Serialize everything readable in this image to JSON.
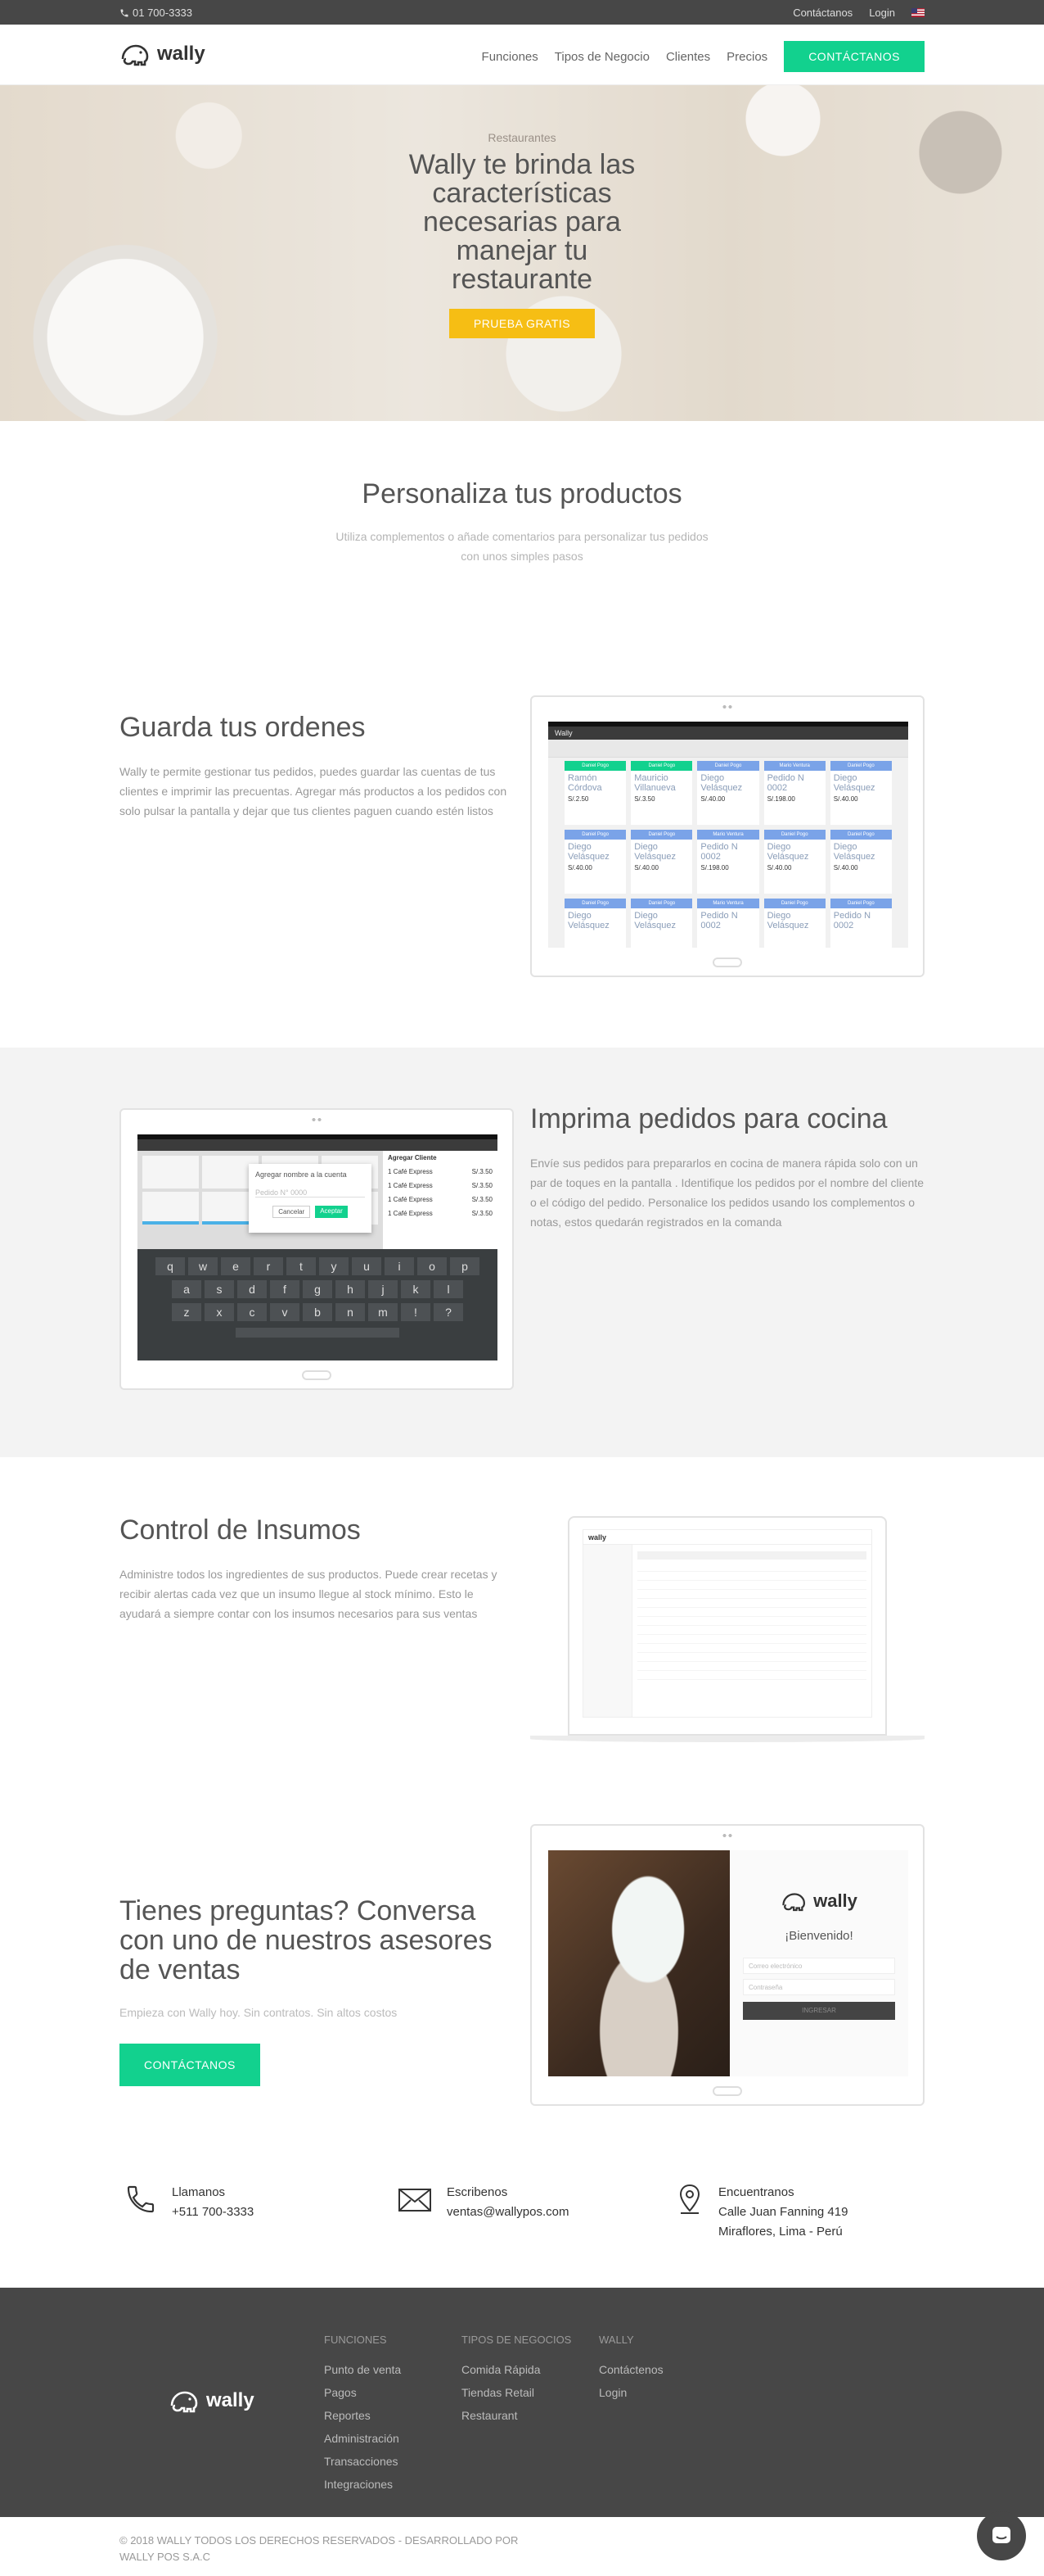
{
  "topbar": {
    "phone": "01 700-3333",
    "contact": "Contáctanos",
    "login": "Login",
    "lang_icon": "us-flag-icon"
  },
  "nav": {
    "logo": "wally",
    "items": [
      "Funciones",
      "Tipos de Negocio",
      "Clientes",
      "Precios"
    ],
    "cta": "CONTÁCTANOS"
  },
  "hero": {
    "kicker": "Restaurantes",
    "title": "Wally te brinda las características necesarias para manejar tu restaurante",
    "cta": "PRUEBA GRATIS"
  },
  "products": {
    "title": "Personaliza tus productos",
    "subtitle": "Utiliza complementos o añade comentarios para personalizar tus pedidos con unos simples pasos"
  },
  "feature1": {
    "title": "Guarda tus ordenes",
    "text": "Wally te permite gestionar tus pedidos, puedes guardar las cuentas de tus clientes e imprimir las precuentas. Agregar más productos a los pedidos con solo pulsar la pantalla y dejar que tus clientes paguen cuando estén listos",
    "app_title": "Wally",
    "cards": [
      {
        "head": "Daniel Pogo",
        "name": "Ramón Córdova",
        "amount": "S/.2.50",
        "head_color": "#12d18e"
      },
      {
        "head": "Daniel Pogo",
        "name": "Mauricio Villanueva",
        "amount": "S/.3.50",
        "head_color": "#12d18e"
      },
      {
        "head": "Daniel Pogo",
        "name": "Diego Velásquez",
        "amount": "S/.40.00",
        "head_color": "#7aa3e8"
      },
      {
        "head": "Mario Ventura",
        "name": "Pedido N 0002",
        "amount": "S/.198.00",
        "head_color": "#7aa3e8"
      },
      {
        "head": "Daniel Pogo",
        "name": "Diego Velásquez",
        "amount": "S/.40.00",
        "head_color": "#7aa3e8"
      },
      {
        "head": "Daniel Pogo",
        "name": "Diego Velásquez",
        "amount": "S/.40.00",
        "head_color": "#7aa3e8"
      },
      {
        "head": "Daniel Pogo",
        "name": "Diego Velásquez",
        "amount": "S/.40.00",
        "head_color": "#7aa3e8"
      },
      {
        "head": "Mario Ventura",
        "name": "Pedido N 0002",
        "amount": "S/.198.00",
        "head_color": "#7aa3e8"
      },
      {
        "head": "Daniel Pogo",
        "name": "Diego Velásquez",
        "amount": "S/.40.00",
        "head_color": "#7aa3e8"
      },
      {
        "head": "Daniel Pogo",
        "name": "Diego Velásquez",
        "amount": "S/.40.00",
        "head_color": "#7aa3e8"
      },
      {
        "head": "Daniel Pogo",
        "name": "Diego Velásquez",
        "amount": "",
        "head_color": "#7aa3e8"
      },
      {
        "head": "Daniel Pogo",
        "name": "Diego Velásquez",
        "amount": "",
        "head_color": "#7aa3e8"
      },
      {
        "head": "Mario Ventura",
        "name": "Pedido N 0002",
        "amount": "",
        "head_color": "#7aa3e8"
      },
      {
        "head": "Daniel Pogo",
        "name": "Diego Velásquez",
        "amount": "",
        "head_color": "#7aa3e8"
      },
      {
        "head": "Daniel Pogo",
        "name": "Pedido N 0002",
        "amount": "",
        "head_color": "#7aa3e8"
      }
    ]
  },
  "feature2": {
    "title": "Imprima pedidos para cocina",
    "text": "Envíe sus pedidos para prepararlos en cocina de manera rápida solo con un par de toques en la pantalla . Identifique los pedidos por el nombre del cliente o el código del pedido. Personalice los pedidos usando los complementos o notas, estos quedarán registrados en la comanda",
    "dialog_title": "Agregar nombre a la cuenta",
    "dialog_placeholder": "Pedido N° 0000",
    "dialog_cancel": "Cancelar",
    "dialog_accept": "Aceptar",
    "order_title": "Agregar Cliente",
    "order_items": [
      {
        "name": "1 Café Express",
        "price": "S/.3.50"
      },
      {
        "name": "1 Café Express",
        "price": "S/.3.50"
      },
      {
        "name": "1 Café Express",
        "price": "S/.3.50"
      },
      {
        "name": "1 Café Express",
        "price": "S/.3.50"
      }
    ],
    "kb_rows": [
      [
        "q",
        "w",
        "e",
        "r",
        "t",
        "y",
        "u",
        "i",
        "o",
        "p"
      ],
      [
        "a",
        "s",
        "d",
        "f",
        "g",
        "h",
        "j",
        "k",
        "l"
      ],
      [
        "z",
        "x",
        "c",
        "v",
        "b",
        "n",
        "m",
        "!",
        "?"
      ]
    ]
  },
  "feature3": {
    "title": "Control de Insumos",
    "text": "Administre todos los ingredientes de sus productos. Puede crear recetas y recibir alertas cada vez que un insumo llegue al stock mínimo. Esto le ayudará a siempre contar con los insumos necesarios para sus ventas"
  },
  "cta_section": {
    "title": "Tienes preguntas? Conversa con uno de nuestros asesores de ventas",
    "subtitle": "Empieza con Wally hoy. Sin contratos. Sin altos costos",
    "button": "CONTÁCTANOS",
    "welcome": "¡Bienvenido!",
    "login_email": "Correo electrónico",
    "login_password": "Contraseña",
    "login_button": "INGRESAR"
  },
  "contact": [
    {
      "icon": "phone-icon",
      "label": "Llamanos",
      "value": "+511 700-3333"
    },
    {
      "icon": "envelope-icon",
      "label": "Escribenos",
      "value": "ventas@wallypos.com"
    },
    {
      "icon": "location-pin-icon",
      "label": "Encuentranos",
      "value": "Calle Juan Fanning 419 Miraflores, Lima - Perú"
    }
  ],
  "footer": {
    "logo": "wally",
    "col1": {
      "title": "FUNCIONES",
      "items": [
        "Punto de venta",
        "Pagos",
        "Reportes",
        "Administración",
        "Transacciones",
        "Integraciones"
      ]
    },
    "col2": {
      "title": "TIPOS DE NEGOCIOS",
      "items": [
        "Comida Rápida",
        "Tiendas Retail",
        "Restaurant"
      ]
    },
    "col3": {
      "title": "WALLY",
      "items": [
        "Contáctenos",
        "Login"
      ]
    },
    "copyright": "© 2018 WALLY TODOS LOS DERECHOS RESERVADOS - DESARROLLADO POR WALLY POS S.A.C"
  }
}
